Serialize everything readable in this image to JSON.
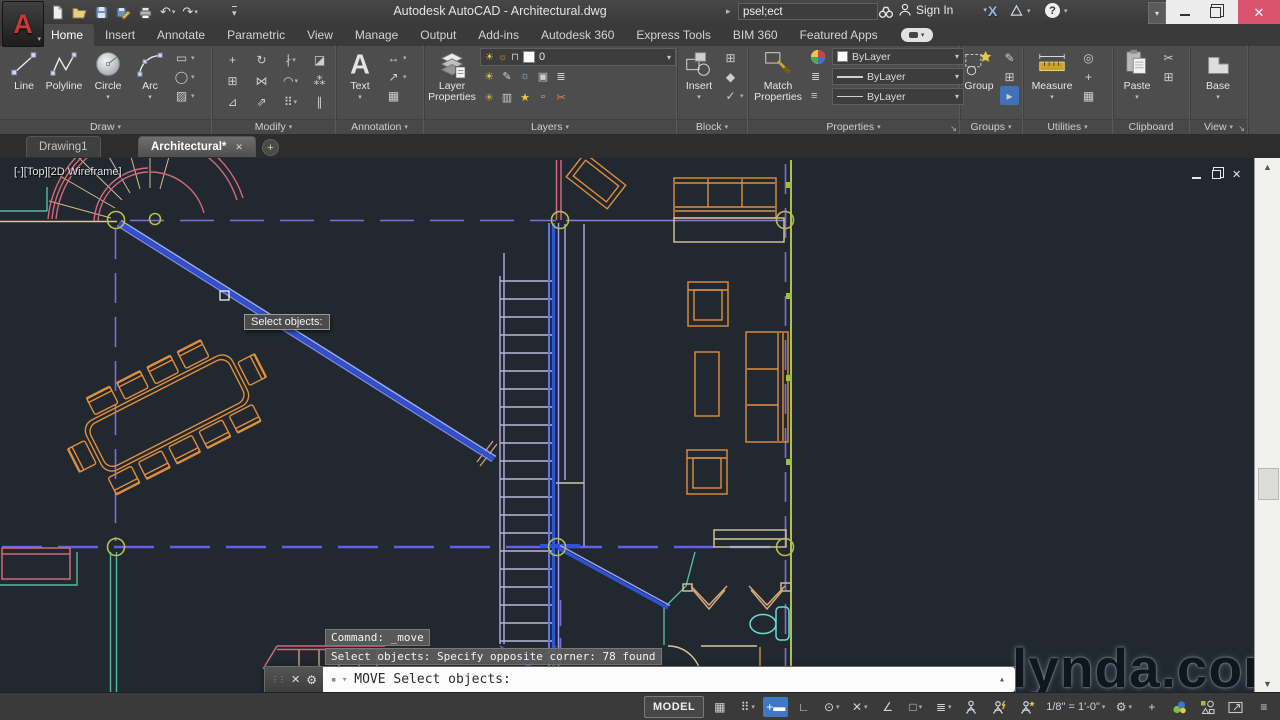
{
  "window": {
    "title": "Autodesk AutoCAD - Architectural.dwg",
    "search_value": "psel;ect",
    "sign_in_label": "Sign In",
    "exchange_glyph": "X",
    "help_glyph": "?",
    "close_glyph": "✕"
  },
  "qat": {
    "items": [
      {
        "name": "new-file",
        "kind": "svg"
      },
      {
        "name": "open-file",
        "kind": "svg"
      },
      {
        "name": "save",
        "kind": "svg"
      },
      {
        "name": "save-as",
        "kind": "svg"
      },
      {
        "name": "plot",
        "kind": "svg"
      },
      {
        "name": "undo",
        "kind": "text",
        "glyph": "↶",
        "dropdown": true
      },
      {
        "name": "redo",
        "kind": "text",
        "glyph": "↷",
        "dropdown": true
      }
    ],
    "overflow_glyph": "▾"
  },
  "ribbon": {
    "tabs": [
      {
        "label": "Home",
        "active": true
      },
      {
        "label": "Insert"
      },
      {
        "label": "Annotate"
      },
      {
        "label": "Parametric"
      },
      {
        "label": "View"
      },
      {
        "label": "Manage"
      },
      {
        "label": "Output"
      },
      {
        "label": "Add-ins"
      },
      {
        "label": "Autodesk 360"
      },
      {
        "label": "Express Tools"
      },
      {
        "label": "BIM 360"
      },
      {
        "label": "Featured Apps"
      }
    ],
    "panels": {
      "draw": {
        "label": "Draw",
        "line": "Line",
        "polyline": "Polyline",
        "circle": "Circle",
        "arc": "Arc",
        "small": [
          {
            "name": "rectangle-tool",
            "glyph": "▭",
            "dd": true
          },
          {
            "name": "ellipse-tool",
            "glyph": "◯",
            "dd": true
          },
          {
            "name": "hatch-tool",
            "glyph": "▨",
            "dd": true
          }
        ]
      },
      "modify": {
        "label": "Modify",
        "tools": [
          {
            "name": "move",
            "glyph": "+",
            "dd": false
          },
          {
            "name": "copy",
            "glyph": "⊞",
            "dd": false
          },
          {
            "name": "stretch",
            "glyph": "⊿",
            "dd": false
          },
          {
            "name": "rotate",
            "glyph": "↻",
            "dd": false
          },
          {
            "name": "mirror",
            "glyph": "⋈",
            "dd": false
          },
          {
            "name": "scale",
            "glyph": "⇗",
            "dd": false
          },
          {
            "name": "trim",
            "glyph": "∤",
            "dd": true
          },
          {
            "name": "fillet",
            "glyph": "◠",
            "dd": true
          },
          {
            "name": "array",
            "glyph": "⠿",
            "dd": true
          },
          {
            "name": "erase",
            "glyph": "◪",
            "dd": false
          },
          {
            "name": "explode",
            "glyph": "⁂",
            "dd": false
          },
          {
            "name": "offset",
            "glyph": "∥",
            "dd": false
          }
        ]
      },
      "annotation": {
        "label": "Annotation",
        "text": "Text",
        "small": [
          {
            "name": "dimension-tool",
            "glyph": "↔",
            "dd": true
          },
          {
            "name": "leader-tool",
            "glyph": "↗",
            "dd": true
          },
          {
            "name": "table-tool",
            "glyph": "▦",
            "dd": false
          }
        ]
      },
      "layers": {
        "label": "Layers",
        "button": "Layer Properties",
        "current_layer": "0",
        "row1": [
          {
            "name": "layer-off",
            "glyph": "☀",
            "color": "#e8c944"
          },
          {
            "name": "layer-isolate",
            "glyph": "✎",
            "color": "#cdcdcd"
          },
          {
            "name": "layer-freeze",
            "glyph": "☼",
            "color": "#9ab8d8"
          },
          {
            "name": "layer-lock",
            "glyph": "▣",
            "color": "#cdcdcd"
          },
          {
            "name": "layer-states",
            "glyph": "≣",
            "color": "#cdcdcd"
          }
        ],
        "row2": [
          {
            "name": "layer-on",
            "glyph": "☀",
            "color": "#c8b050"
          },
          {
            "name": "layer-match",
            "glyph": "▥",
            "color": "#cdcdcd"
          },
          {
            "name": "layer-thaw",
            "glyph": "★",
            "color": "#e8c944"
          },
          {
            "name": "layer-unlock",
            "glyph": "▫",
            "color": "#cdcdcd"
          },
          {
            "name": "layer-delete",
            "glyph": "✂",
            "color": "#d88a5a"
          }
        ]
      },
      "block": {
        "label": "Block",
        "insert": "Insert",
        "small": [
          {
            "name": "create-block",
            "glyph": "⊞",
            "dd": false
          },
          {
            "name": "edit-attributes",
            "glyph": "◆",
            "dd": false
          },
          {
            "name": "define-attributes",
            "glyph": "✓",
            "dd": true
          }
        ]
      },
      "properties": {
        "label": "Properties",
        "match": "Match Properties",
        "values": [
          "ByLayer",
          "ByLayer",
          "ByLayer"
        ]
      },
      "groups": {
        "label": "Groups",
        "group": "Group",
        "small": [
          {
            "name": "ungroup",
            "glyph": "✎",
            "dd": false
          },
          {
            "name": "group-edit",
            "glyph": "⊞",
            "dd": false
          },
          {
            "name": "group-selection",
            "glyph": "▸",
            "dd": false,
            "active": true
          }
        ]
      },
      "utilities": {
        "label": "Utilities",
        "measure": "Measure",
        "small": [
          {
            "name": "quick-select",
            "glyph": "◎",
            "dd": false
          },
          {
            "name": "id-point",
            "glyph": "+",
            "dd": false
          },
          {
            "name": "quick-calculator",
            "glyph": "▦",
            "dd": false
          }
        ]
      },
      "clipboard": {
        "label": "Clipboard",
        "paste": "Paste",
        "small": [
          {
            "name": "cut",
            "glyph": "✂",
            "dd": false
          },
          {
            "name": "copy-clip",
            "glyph": "⊞",
            "dd": false
          }
        ]
      },
      "view": {
        "label": "View",
        "base": "Base"
      }
    }
  },
  "file_tabs": {
    "tabs": [
      {
        "label": "Drawing1",
        "active": false,
        "closable": false
      },
      {
        "label": "Architectural*",
        "active": true,
        "closable": true
      }
    ],
    "close_glyph": "✕",
    "new_tab_glyph": "+"
  },
  "viewport": {
    "controls_label": "[-][Top][2D Wireframe]",
    "tooltip": "Select objects:"
  },
  "command": {
    "history": [
      "Command: _move",
      "Select objects: Specify opposite corner: 78 found"
    ],
    "prompt": "MOVE Select objects:",
    "autocomplete_caret": "▴"
  },
  "status_bar": {
    "items": [
      {
        "name": "model-toggle",
        "kind": "label",
        "label": "MODEL"
      },
      {
        "name": "grid-display",
        "kind": "text",
        "glyph": "▦"
      },
      {
        "name": "snap-mode",
        "kind": "text",
        "glyph": "⠿",
        "dd": true
      },
      {
        "name": "dynamic-input",
        "kind": "text",
        "glyph": "+▬",
        "active": true
      },
      {
        "name": "ortho-mode",
        "kind": "text",
        "glyph": "∟"
      },
      {
        "name": "polar-tracking",
        "kind": "text",
        "glyph": "⊙",
        "dd": true
      },
      {
        "name": "isometric-drafting",
        "kind": "text",
        "glyph": "✕",
        "dd": true
      },
      {
        "name": "object-snap-tracking",
        "kind": "text",
        "glyph": "∠"
      },
      {
        "name": "object-snap",
        "kind": "text",
        "glyph": "□",
        "dd": true
      },
      {
        "name": "lineweight-display",
        "kind": "text",
        "glyph": "≣",
        "dd": true
      },
      {
        "name": "annotation-visibility",
        "kind": "svg",
        "sym": "person"
      },
      {
        "name": "annotation-autoscale",
        "kind": "svg",
        "sym": "person-bolt"
      },
      {
        "name": "annotation-scale-flag",
        "kind": "svg",
        "sym": "person-star"
      },
      {
        "name": "annotation-scale",
        "kind": "label",
        "label": "1/8\" = 1'-0\"",
        "dd": true,
        "cls": "scale"
      },
      {
        "name": "workspace-switching",
        "kind": "text",
        "glyph": "⚙",
        "dd": true
      },
      {
        "name": "customize-plus",
        "kind": "text",
        "glyph": "+"
      },
      {
        "name": "hardware-acceleration",
        "kind": "svg",
        "sym": "workspace"
      },
      {
        "name": "isolate-objects",
        "kind": "svg",
        "sym": "isolate"
      },
      {
        "name": "clean-screen",
        "kind": "svg",
        "sym": "clean"
      },
      {
        "name": "customization-menu",
        "kind": "text",
        "glyph": "≡"
      }
    ]
  },
  "watermark": "lynda.com",
  "colors": {
    "canvas_bg": "#212830",
    "ribbon_bg": "#4d4d4d",
    "selection_blue": "#2f54e0",
    "furniture_orange": "#e08f3c",
    "centerline_purple": "#7e6fd6",
    "exterior_wall_yellowgreen": "#c3cf52",
    "teal": "#59b8a0",
    "stair_red": "#d4697a",
    "fixture_cyan": "#6fd9d4",
    "close_button_red": "#d9536f",
    "status_accent_blue": "#3f78c3"
  }
}
